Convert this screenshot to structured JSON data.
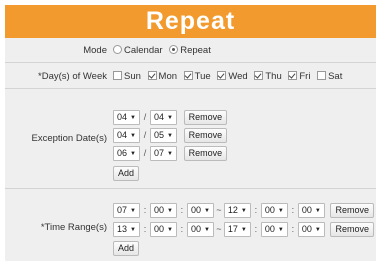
{
  "title": "Repeat",
  "mode": {
    "label": "Mode",
    "options": [
      "Calendar",
      "Repeat"
    ],
    "selected": "Repeat"
  },
  "days": {
    "label": "*Day(s) of Week",
    "items": [
      {
        "label": "Sun",
        "checked": false
      },
      {
        "label": "Mon",
        "checked": true
      },
      {
        "label": "Tue",
        "checked": true
      },
      {
        "label": "Wed",
        "checked": true
      },
      {
        "label": "Thu",
        "checked": true
      },
      {
        "label": "Fri",
        "checked": true
      },
      {
        "label": "Sat",
        "checked": false
      }
    ]
  },
  "exceptions": {
    "label": "Exception Date(s)",
    "rows": [
      {
        "month": "04",
        "day": "04"
      },
      {
        "month": "04",
        "day": "05"
      },
      {
        "month": "06",
        "day": "07"
      }
    ],
    "separator": "/",
    "remove_label": "Remove",
    "add_label": "Add"
  },
  "time_ranges": {
    "label": "*Time Range(s)",
    "rows": [
      {
        "start": [
          "07",
          "00",
          "00"
        ],
        "end": [
          "12",
          "00",
          "00"
        ]
      },
      {
        "start": [
          "13",
          "00",
          "00"
        ],
        "end": [
          "17",
          "00",
          "00"
        ]
      }
    ],
    "time_separator": ":",
    "range_separator": "~",
    "remove_label": "Remove",
    "add_label": "Add"
  },
  "icons": {
    "dropdown": "chevron-down-icon"
  }
}
